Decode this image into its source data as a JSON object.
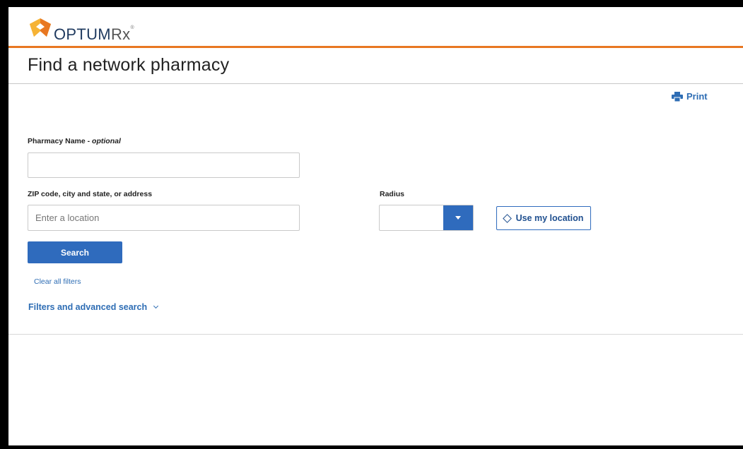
{
  "brand": {
    "name_bold": "OPTUM",
    "name_rx": "Rx",
    "reg": "®",
    "accent_color": "#e87722",
    "primary_color": "#2f6bbd"
  },
  "page": {
    "title": "Find a network pharmacy"
  },
  "toolbar": {
    "print_label": "Print",
    "print_icon": "printer-icon"
  },
  "form": {
    "pharmacy_name_label": "Pharmacy Name - ",
    "pharmacy_name_optional": "optional",
    "pharmacy_name_value": "",
    "location_label": "ZIP code, city and state, or address",
    "location_placeholder": "Enter a location",
    "radius_label": "Radius",
    "radius_value": "",
    "use_location_label": "Use my location",
    "search_label": "Search",
    "clear_label": "Clear all filters",
    "filters_label": "Filters and advanced search"
  }
}
